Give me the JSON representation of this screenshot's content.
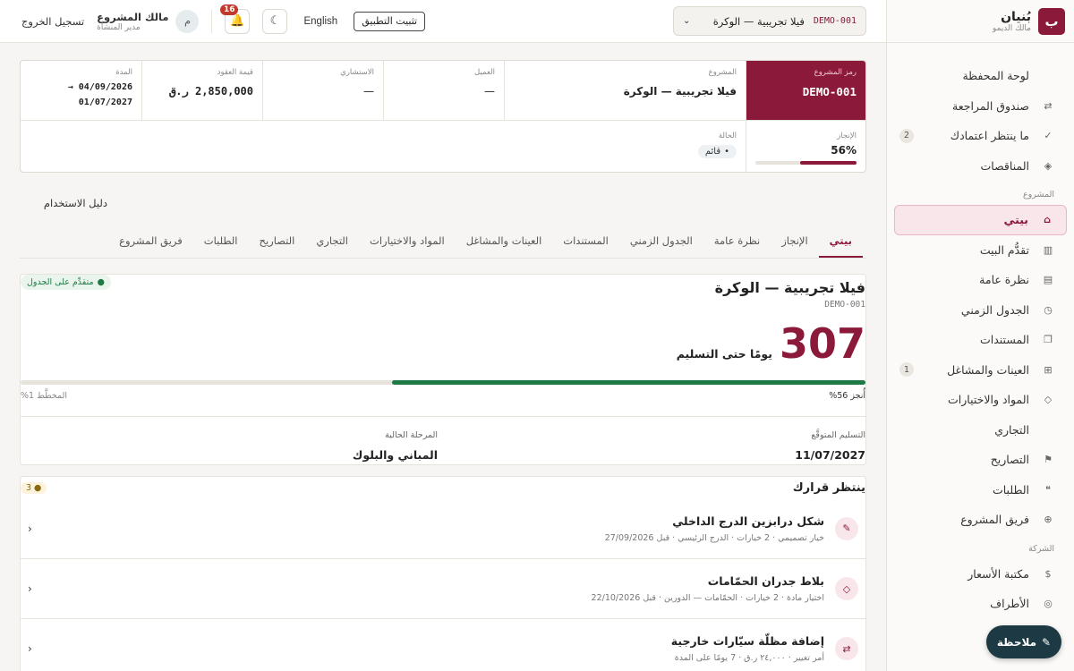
{
  "brand": {
    "logo_letter": "ب",
    "name": "بُنيان",
    "subtitle": "مالك الديمو"
  },
  "sidebar": {
    "items": [
      {
        "label": "لوحة المحفظة",
        "icon": ""
      },
      {
        "label": "صندوق المراجعة",
        "icon": "⇄"
      },
      {
        "label": "ما ينتظر اعتمادك",
        "icon": "✓",
        "badge": "2"
      }
    ],
    "items2": [
      {
        "label": "المناقصات",
        "icon": "◈"
      }
    ],
    "section_project": "المشروع",
    "project_items": [
      {
        "label": "بيتي",
        "icon": "⌂"
      },
      {
        "label": "تقدُّم البيت",
        "icon": "▥"
      },
      {
        "label": "نظرة عامة",
        "icon": "▤"
      },
      {
        "label": "الجدول الزمني",
        "icon": "◷"
      },
      {
        "label": "المستندات",
        "icon": "❐"
      },
      {
        "label": "العينات والمشاغل",
        "icon": "⊞",
        "badge": "1"
      },
      {
        "label": "المواد والاختيارات",
        "icon": "◇"
      },
      {
        "label": "التجاري",
        "icon": ""
      },
      {
        "label": "التصاريح",
        "icon": "⚑"
      },
      {
        "label": "الطلبات",
        "icon": "❝"
      },
      {
        "label": "فريق المشروع",
        "icon": "⊕"
      }
    ],
    "section_company": "الشركة",
    "company_items": [
      {
        "label": "مكتبة الأسعار",
        "icon": "$"
      },
      {
        "label": "الأطراف",
        "icon": "◎"
      }
    ]
  },
  "topbar": {
    "project_code": "DEMO-001",
    "project_name": "فيلا تجريبية — الوكرة",
    "chevron": "⌄",
    "install_label": "تثبيت التطبيق",
    "lang_label": "English",
    "theme_icon": "☾",
    "notif_count": "16",
    "avatar_letter": "م",
    "user_name": "مالك المشروع",
    "user_role": "مدير المنشأة",
    "logout_label": "تسجيل الخروج"
  },
  "summary": {
    "code_label": "رمز المشروع",
    "code_value": "DEMO-001",
    "project_label": "المشروع",
    "project_value": "فيلا تجريبية — الوكرة",
    "client_label": "العميل",
    "client_value": "—",
    "consultant_label": "الاستشاري",
    "consultant_value": "—",
    "contract_label": "قيمة العقود",
    "contract_value": "2,850,000 ر.ق",
    "duration_label": "المدة",
    "duration_start": "04/09/2026 →",
    "duration_end": "01/07/2027",
    "progress_label": "الإنجاز",
    "progress_value": "56%",
    "progress_fraction": 0.56,
    "status_label": "الحالة",
    "status_value": "قائم"
  },
  "guide_label": "دليل الاستخدام",
  "tabs": [
    "بيتي",
    "الإنجاز",
    "نظرة عامة",
    "الجدول الزمني",
    "المستندات",
    "العينات والمشاغل",
    "المواد والاختيارات",
    "التجاري",
    "التصاريح",
    "الطلبات",
    "فريق المشروع"
  ],
  "house": {
    "title": "فيلا تجريبية — الوكرة",
    "code": "DEMO-001",
    "status_pill": "متقدِّم على الجدول",
    "days": "307",
    "days_label": "يومًا حتى التسليم",
    "done_label": "أُنجز 56%",
    "done_fraction": 0.56,
    "planned_label": "المخطَّط 1%",
    "delivery_label": "التسليم المتوقَّع",
    "delivery_value": "11/07/2027",
    "phase_label": "المرحلة الحالية",
    "phase_value": "المباني والبلوك"
  },
  "decisions": {
    "title": "ينتظر قرارك",
    "count": "3",
    "items": [
      {
        "icon": "✎",
        "name": "شكل درابزين الدرج الداخلي",
        "meta": "خيار تصميمي · 2 خيارات · الدرج الرئيسي · قبل 27/09/2026"
      },
      {
        "icon": "◇",
        "name": "بلاط جدران الحمّامات",
        "meta": "اختيار مادة · 2 خيارات · الحمّامات — الدورين · قبل 22/10/2026"
      },
      {
        "icon": "⇄",
        "name": "إضافة مظلّة سيّارات خارجية",
        "meta": "أمر تغيير · ٢٤,٠٠٠ ر.ق · 7 يومًا على المدة"
      }
    ]
  },
  "note_button": {
    "icon": "✎",
    "label": "ملاحظة"
  },
  "colors": {
    "brand": "#8b1a3a",
    "success": "#1d7a45",
    "fab": "#1d3a44"
  }
}
